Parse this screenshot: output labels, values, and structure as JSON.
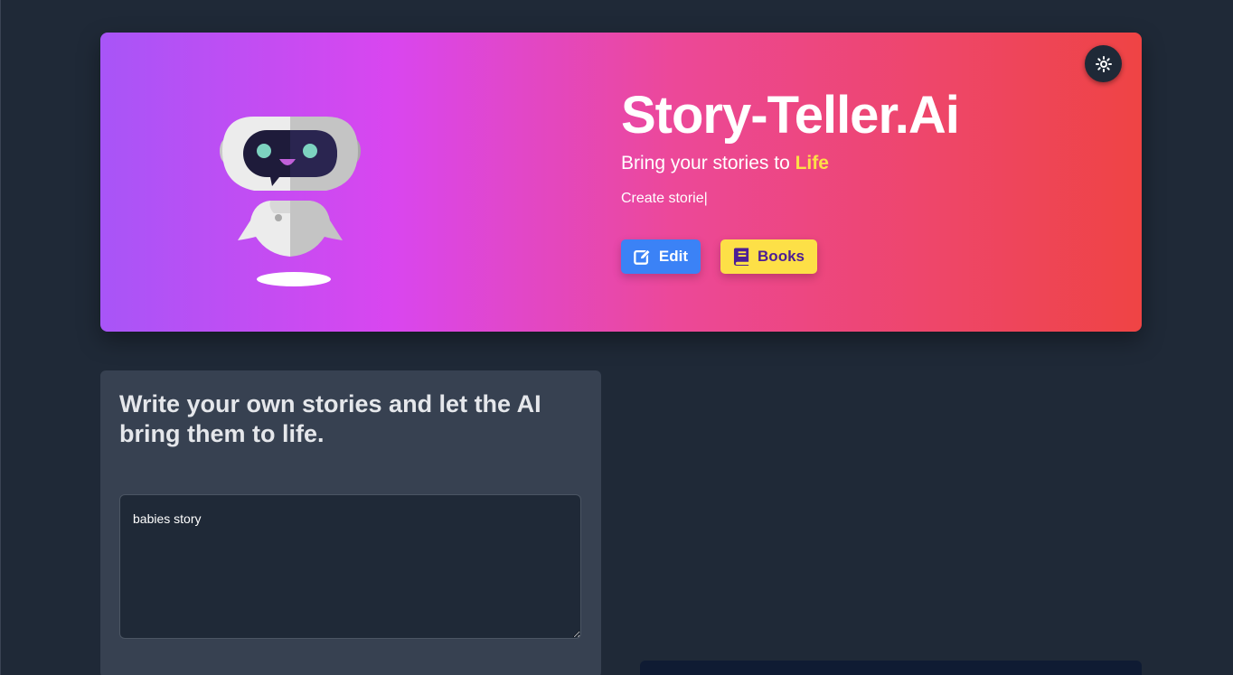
{
  "hero": {
    "title": "Story-Teller.Ai",
    "subtitle_prefix": "Bring your stories to ",
    "subtitle_accent": "Life",
    "typing_text": "Create storie|",
    "edit_label": "Edit",
    "books_label": "Books",
    "theme_toggle_icon": "sun-icon"
  },
  "editor": {
    "heading": "Write your own stories and let the AI bring them to life.",
    "story_value": "babies story"
  },
  "colors": {
    "background": "#1f2937",
    "gradient_start": "#a855f7",
    "gradient_mid": "#ec4899",
    "gradient_end": "#ef4444",
    "accent_yellow": "#fde047",
    "edit_blue": "#3b82f6",
    "card": "#374151"
  }
}
